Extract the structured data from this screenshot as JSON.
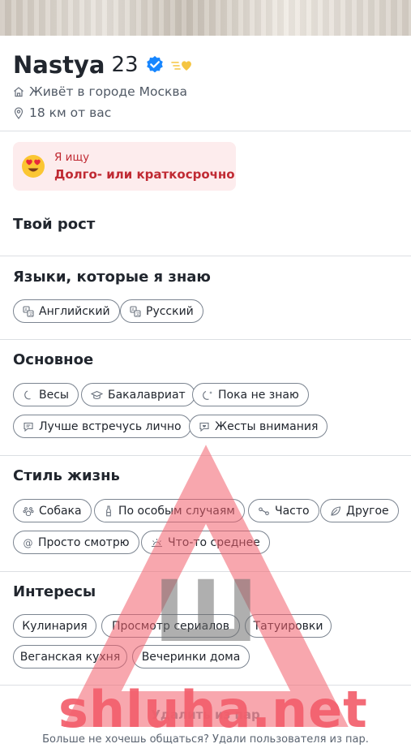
{
  "profile": {
    "name": "Nastya",
    "age": "23",
    "city": "Живёт в городе Москва",
    "distance": "18 км от вас"
  },
  "looking_for": {
    "label": "Я ищу",
    "value": "Долго- или краткосрочно",
    "emoji": "heart-eyes-emoji"
  },
  "height": {
    "title": "Твой рост"
  },
  "languages": {
    "title": "Языки, которые я знаю",
    "items": [
      {
        "label": "Английский",
        "icon": "translate-icon"
      },
      {
        "label": "Русский",
        "icon": "translate-icon"
      }
    ]
  },
  "basics": {
    "title": "Основное",
    "items": [
      {
        "label": "Весы",
        "icon": "moon-icon"
      },
      {
        "label": "Бакалавриат",
        "icon": "graduation-cap-icon"
      },
      {
        "label": "Пока не знаю",
        "icon": "moon-star-icon"
      },
      {
        "label": "Лучше встречусь лично",
        "icon": "chat-bubble-icon"
      },
      {
        "label": "Жесты внимания",
        "icon": "heart-message-icon"
      }
    ]
  },
  "lifestyle": {
    "title": "Стиль жизнь",
    "items": [
      {
        "label": "Собака",
        "icon": "paw-icon"
      },
      {
        "label": "По особым случаям",
        "icon": "bottle-icon"
      },
      {
        "label": "Часто",
        "icon": "dumbbell-icon"
      },
      {
        "label": "Другое",
        "icon": "leaf-icon"
      },
      {
        "label": "Просто смотрю",
        "icon": "at-icon"
      },
      {
        "label": "Что-то среднее",
        "icon": "sunrise-icon"
      }
    ]
  },
  "interests": {
    "title": "Интересы",
    "items": [
      {
        "label": "Кулинария"
      },
      {
        "label": "Просмотр сериалов"
      },
      {
        "label": "Татуировки"
      },
      {
        "label": "Веганская кухня"
      },
      {
        "label": "Вечеринки дома"
      }
    ]
  },
  "footer": {
    "delete_label": "Удалить из пар",
    "delete_sub": "Больше не хочешь общаться? Удали пользователя из пар."
  },
  "watermark": {
    "text": "shluha.net",
    "letter": "Ш"
  },
  "colors": {
    "accent_red": "#c02a33",
    "verified_blue": "#1786ff",
    "watermark_red": "#f35f6c"
  }
}
